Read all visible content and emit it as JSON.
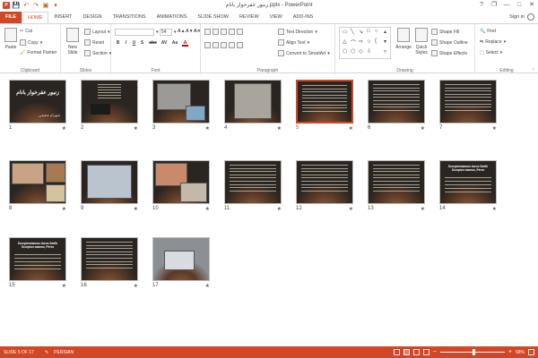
{
  "window": {
    "title": "زنبور عقرخوار بانام.pptx - PowerPoint",
    "controls": {
      "help": "?",
      "restore": "❐",
      "minimize": "—",
      "maximize": "□",
      "close": "✕"
    }
  },
  "qat": {
    "app_icon": "P",
    "save": "💾",
    "undo": "↶",
    "redo": "↷",
    "present": "▣",
    "customize": "▾"
  },
  "tabs": [
    "FILE",
    "HOME",
    "INSERT",
    "DESIGN",
    "TRANSITIONS",
    "ANIMATIONS",
    "SLIDE SHOW",
    "REVIEW",
    "VIEW",
    "ADD-INS"
  ],
  "active_tab": "HOME",
  "signin": "Sign in",
  "ribbon": {
    "clipboard": {
      "label": "Clipboard",
      "paste": "Paste",
      "cut": "Cut",
      "copy": "Copy",
      "format_painter": "Format Painter"
    },
    "slides": {
      "label": "Slides",
      "new_slide": "New Slide",
      "layout": "Layout",
      "reset": "Reset",
      "section": "Section"
    },
    "font": {
      "label": "Font",
      "font_size": "54",
      "bold": "B",
      "italic": "I",
      "underline": "U",
      "shadow": "S",
      "strike": "abc",
      "spacing": "AV",
      "case": "Aa",
      "color": "A",
      "grow": "A▲",
      "shrink": "A▼",
      "clear": "A✕"
    },
    "paragraph": {
      "label": "Paragraph",
      "text_direction": "Text Direction",
      "align_text": "Align Text",
      "convert_smartart": "Convert to SmartArt"
    },
    "drawing": {
      "label": "Drawing",
      "arrange": "Arrange",
      "quick_styles": "Quick Styles",
      "shape_fill": "Shape Fill",
      "shape_outline": "Shape Outline",
      "shape_effects": "Shape Effects"
    },
    "editing": {
      "label": "Editing",
      "find": "Find",
      "replace": "Replace",
      "select": "Select"
    }
  },
  "slides": [
    {
      "num": "1",
      "title_text": "زنبور عقرخوار بانام",
      "caption": "شهرام شفيعي"
    },
    {
      "num": "2"
    },
    {
      "num": "3"
    },
    {
      "num": "4"
    },
    {
      "num": "5"
    },
    {
      "num": "6"
    },
    {
      "num": "7"
    },
    {
      "num": "8"
    },
    {
      "num": "9"
    },
    {
      "num": "10"
    },
    {
      "num": "11"
    },
    {
      "num": "12"
    },
    {
      "num": "13"
    },
    {
      "num": "14",
      "heading": "Scorpionmamus durus Smith Scorpion mamus, Pérez"
    },
    {
      "num": "15",
      "heading": "Scorpionmamus durus Smith Scorpion mamus, Pérez"
    },
    {
      "num": "16"
    },
    {
      "num": "17"
    }
  ],
  "selected_slide": "5",
  "transition_mark": "★",
  "status": {
    "slide": "SLIDE 5 OF 17",
    "language": "PERSIAN",
    "zoom": "68%",
    "zoom_fraction": 0.68,
    "zoom_out": "−",
    "zoom_in": "+"
  },
  "colors": {
    "accent": "#d24726",
    "slide_bg": "#2a2520"
  }
}
